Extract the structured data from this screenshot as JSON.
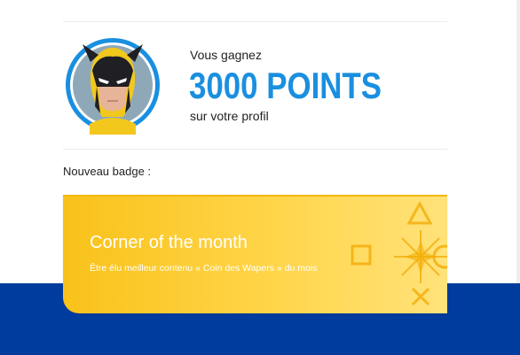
{
  "reward": {
    "win_label": "Vous gagnez",
    "points_label": "3000 POINTS",
    "profile_label": "sur votre profil"
  },
  "badge": {
    "heading": "Nouveau badge :",
    "title": "Corner of the month",
    "description": "Être élu meilleur contenu « Coin des Wapers » du mois"
  },
  "avatar": {
    "icon": "wolverine-mask-icon",
    "ring_color": "#1a8fe0"
  },
  "colors": {
    "accent_blue": "#1a8fe0",
    "badge_gold": "#ffd54a",
    "footer_blue": "#003c9e"
  }
}
